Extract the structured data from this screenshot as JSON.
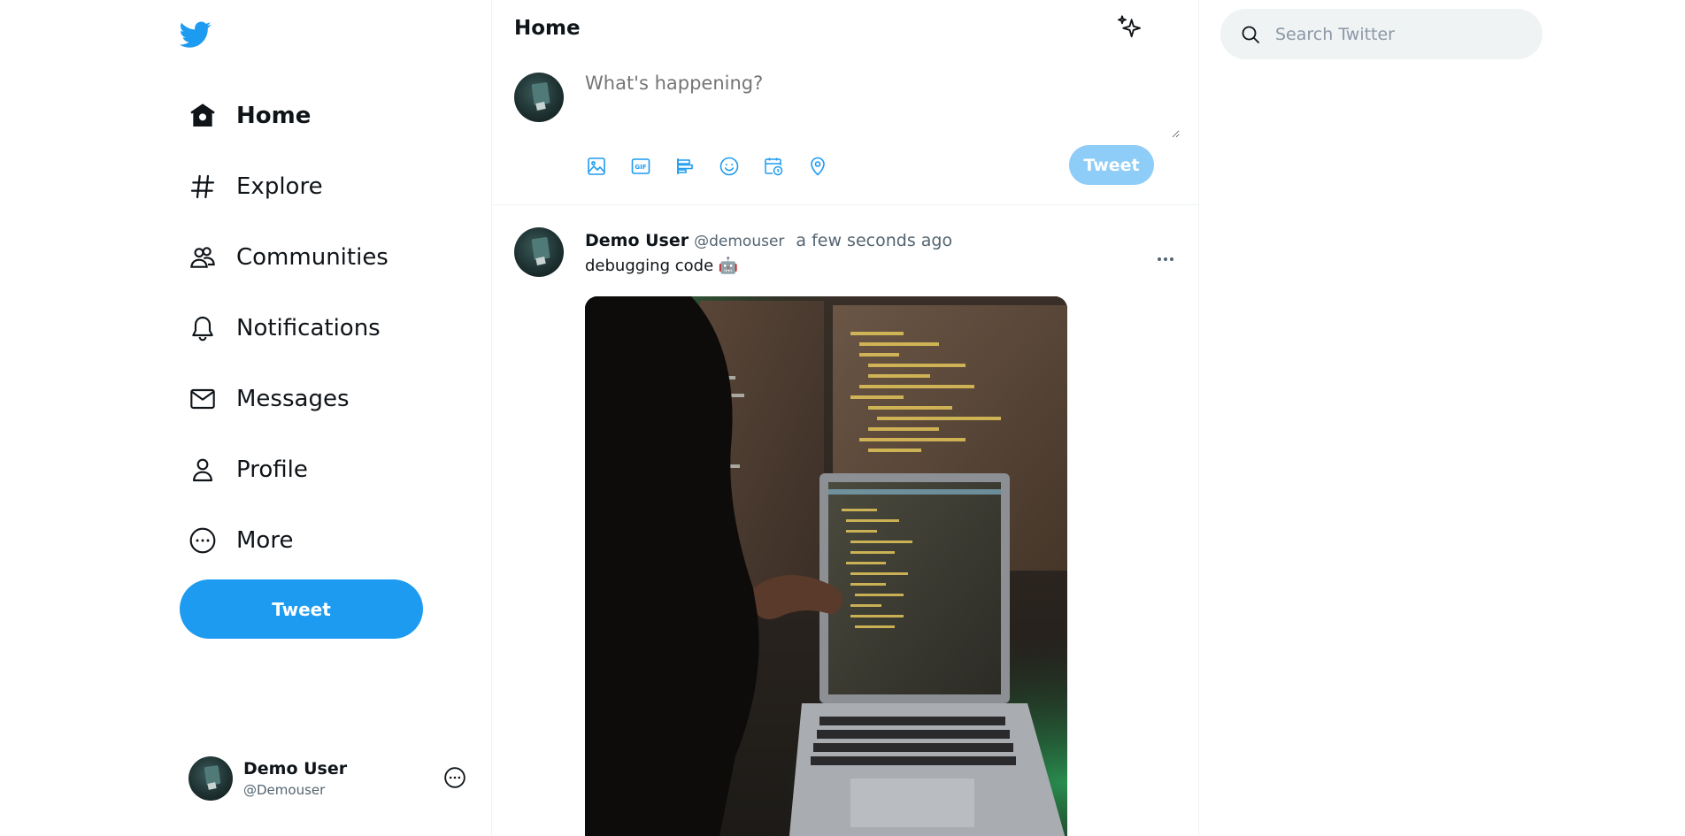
{
  "brand": {
    "logo_icon": "twitter-bird-icon",
    "color": "#1d9bf0"
  },
  "sidebar": {
    "items": [
      {
        "label": "Home",
        "icon": "home-icon",
        "active": true
      },
      {
        "label": "Explore",
        "icon": "hashtag-icon",
        "active": false
      },
      {
        "label": "Communities",
        "icon": "communities-icon",
        "active": false
      },
      {
        "label": "Notifications",
        "icon": "bell-icon",
        "active": false
      },
      {
        "label": "Messages",
        "icon": "envelope-icon",
        "active": false
      },
      {
        "label": "Profile",
        "icon": "person-icon",
        "active": false
      },
      {
        "label": "More",
        "icon": "more-circle-icon",
        "active": false
      }
    ],
    "tweet_button": "Tweet",
    "account": {
      "name": "Demo User",
      "handle": "@Demouser",
      "more_icon": "more-circle-icon"
    }
  },
  "main": {
    "title": "Home",
    "header_icon": "sparkle-icon",
    "composer": {
      "placeholder": "What's happening?",
      "tools": [
        "image-icon",
        "gif-icon",
        "poll-icon",
        "emoji-icon",
        "schedule-icon",
        "location-icon"
      ],
      "tweet_button": "Tweet"
    },
    "tweet": {
      "author": "Demo User",
      "handle": "@demouser",
      "time": "a few seconds ago",
      "text": "debugging code 🤖",
      "more_icon": "ellipsis-icon",
      "media": "photo of person debugging code on a laptop in front of monitors"
    }
  },
  "search": {
    "placeholder": "Search Twitter",
    "icon": "search-icon"
  }
}
